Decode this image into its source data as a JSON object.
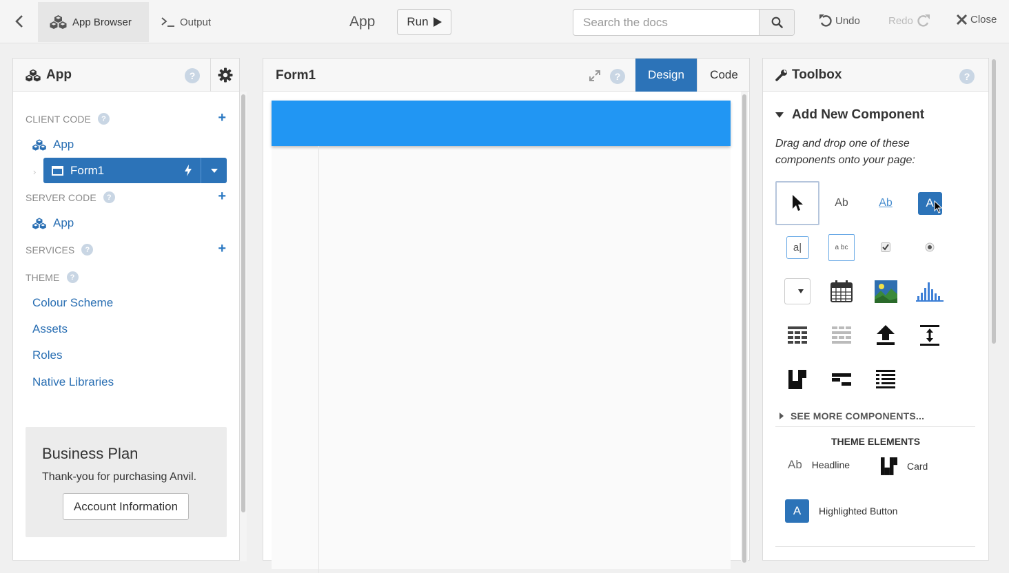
{
  "topbar": {
    "tabs": [
      {
        "label": "App Browser",
        "icon": "cubes-icon",
        "active": true
      },
      {
        "label": "Output",
        "icon": "terminal-icon",
        "active": false
      }
    ],
    "app_name": "App",
    "run_label": "Run",
    "search": {
      "placeholder": "Search the docs",
      "value": ""
    },
    "undo_label": "Undo",
    "redo_label": "Redo",
    "close_label": "Close"
  },
  "left_panel": {
    "title": "App",
    "sections": {
      "client_code": "CLIENT CODE",
      "server_code": "SERVER CODE",
      "services": "SERVICES",
      "theme": "THEME"
    },
    "client_items": {
      "app": "App",
      "form": "Form1"
    },
    "server_items": {
      "app": "App"
    },
    "theme_links": [
      "Colour Scheme",
      "Assets",
      "Roles",
      "Native Libraries"
    ],
    "plan": {
      "title": "Business Plan",
      "text": "Thank-you for purchasing Anvil.",
      "button": "Account Information"
    }
  },
  "center_panel": {
    "title": "Form1",
    "design_label": "Design",
    "code_label": "Code",
    "colors": {
      "nav_bar": "#2196f3",
      "active_tab": "#2c73b8"
    }
  },
  "right_panel": {
    "title": "Toolbox",
    "add_new": "Add New Component",
    "instructions": "Drag and drop one of these components onto your page:",
    "components": [
      {
        "name": "pointer",
        "label": ""
      },
      {
        "name": "label",
        "label": "Ab"
      },
      {
        "name": "link",
        "label": "Ab"
      },
      {
        "name": "button",
        "label": "A"
      },
      {
        "name": "textbox",
        "label": "a"
      },
      {
        "name": "textarea",
        "label": "a bc"
      },
      {
        "name": "checkbox",
        "label": ""
      },
      {
        "name": "radio",
        "label": ""
      },
      {
        "name": "dropdown",
        "label": ""
      },
      {
        "name": "datepicker",
        "label": ""
      },
      {
        "name": "image",
        "label": ""
      },
      {
        "name": "plot",
        "label": ""
      },
      {
        "name": "data-grid",
        "label": ""
      },
      {
        "name": "repeating-panel",
        "label": ""
      },
      {
        "name": "file-loader",
        "label": ""
      },
      {
        "name": "spacer",
        "label": ""
      },
      {
        "name": "column-panel",
        "label": ""
      },
      {
        "name": "flow-panel",
        "label": ""
      },
      {
        "name": "rich-text",
        "label": ""
      }
    ],
    "see_more": "SEE MORE COMPONENTS...",
    "theme_elements_title": "THEME ELEMENTS",
    "theme_elements": [
      {
        "label": "Headline",
        "icon_text": "Ab"
      },
      {
        "label": "Card",
        "icon_text": ""
      },
      {
        "label": "Highlighted Button",
        "icon_text": "A"
      }
    ]
  }
}
